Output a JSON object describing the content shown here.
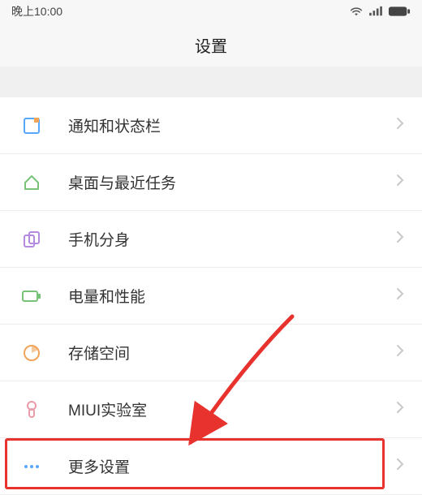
{
  "status": {
    "time": "晚上10:00"
  },
  "header": {
    "title": "设置"
  },
  "items": [
    {
      "icon": "notification-bar-icon",
      "label": "通知和状态栏"
    },
    {
      "icon": "home-icon",
      "label": "桌面与最近任务"
    },
    {
      "icon": "clone-icon",
      "label": "手机分身"
    },
    {
      "icon": "battery-perf-icon",
      "label": "电量和性能"
    },
    {
      "icon": "storage-icon",
      "label": "存储空间"
    },
    {
      "icon": "lab-icon",
      "label": "MIUI实验室"
    },
    {
      "icon": "more-icon",
      "label": "更多设置"
    }
  ],
  "colors": {
    "highlight": "#e8322e",
    "icon_blue": "#58a7ff",
    "icon_green": "#78c37a",
    "icon_purple": "#b58ae0",
    "icon_orange": "#f0a45a",
    "icon_pink": "#e89aa8"
  },
  "annotation": {
    "highlight_target_index": 6
  }
}
